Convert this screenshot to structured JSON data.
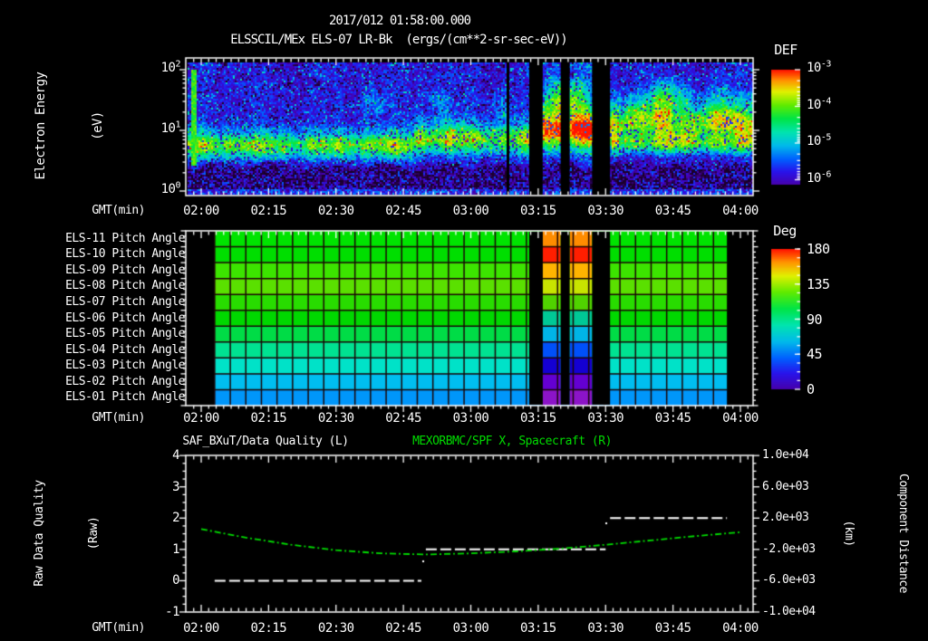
{
  "title": {
    "line1": "2017/012 01:58:00.000",
    "line2": "ELSSCIL/MEx ELS-07 LR-Bk  (ergs/(cm**2-sr-sec-eV))"
  },
  "time_axis": {
    "label": "GMT(min)",
    "ticks": [
      "02:00",
      "02:15",
      "02:30",
      "02:45",
      "03:00",
      "03:15",
      "03:30",
      "03:45",
      "04:00"
    ]
  },
  "panel1": {
    "ylabel": [
      "Electron Energy",
      "(eV)"
    ],
    "yticks": [
      {
        "base": "10",
        "exp": "2"
      },
      {
        "base": "10",
        "exp": "1"
      },
      {
        "base": "10",
        "exp": "0"
      }
    ],
    "colorbar": {
      "title": "DEF",
      "ticks": [
        {
          "base": "10",
          "exp": "-3"
        },
        {
          "base": "10",
          "exp": "-4"
        },
        {
          "base": "10",
          "exp": "-5"
        },
        {
          "base": "10",
          "exp": "-6"
        }
      ]
    }
  },
  "panel2": {
    "row_labels": [
      "ELS-11 Pitch Angle",
      "ELS-10 Pitch Angle",
      "ELS-09 Pitch Angle",
      "ELS-08 Pitch Angle",
      "ELS-07 Pitch Angle",
      "ELS-06 Pitch Angle",
      "ELS-05 Pitch Angle",
      "ELS-04 Pitch Angle",
      "ELS-03 Pitch Angle",
      "ELS-02 Pitch Angle",
      "ELS-01 Pitch Angle"
    ],
    "colorbar": {
      "title": "Deg",
      "ticks": [
        "180",
        "135",
        "90",
        "45",
        "0"
      ]
    }
  },
  "panel3": {
    "title_left": "SAF_BXuT/Data Quality (L)",
    "title_right": "MEXORBMC/SPF X, Spacecraft (R)",
    "title_right_color": "#00dc00",
    "ylabel_left": [
      "Raw Data Quality",
      "(Raw)"
    ],
    "ylabel_right": [
      "Component Distance",
      "(km)"
    ],
    "yticks_left": [
      "4",
      "3",
      "2",
      "1",
      "0",
      "-1"
    ],
    "yticks_right": [
      "1.0e+04",
      "6.0e+03",
      "2.0e+03",
      "-2.0e+03",
      "-6.0e+03",
      "-1.0e+04"
    ]
  },
  "chart_data": [
    {
      "type": "heatmap",
      "panel": "electron-energy-spectrogram",
      "title": "ELSSCIL/MEx ELS-07 LR-Bk",
      "units": "ergs/(cm**2-sr-sec-eV)",
      "xlabel": "GMT(min)",
      "x_range": [
        "02:00",
        "04:00"
      ],
      "ylabel": "Electron Energy (eV)",
      "y_scale": "log",
      "y_range_eV": [
        1,
        150
      ],
      "colorbar": {
        "label": "DEF",
        "scale": "log",
        "range": [
          1e-06,
          0.001
        ]
      },
      "data_gaps": [
        [
          "03:13",
          "03:16"
        ],
        [
          "03:20",
          "03:22"
        ],
        [
          "03:27",
          "03:31"
        ]
      ],
      "features": {
        "main_band_eV": [
          4,
          40
        ],
        "typical_band_value_DEF": 0.0001,
        "dark_below_eV": 3,
        "enhanced_green_after": "03:00"
      }
    },
    {
      "type": "heatmap",
      "panel": "pitch-angle-rows",
      "rows": [
        "ELS-11",
        "ELS-10",
        "ELS-09",
        "ELS-08",
        "ELS-07",
        "ELS-06",
        "ELS-05",
        "ELS-04",
        "ELS-03",
        "ELS-02",
        "ELS-01"
      ],
      "colorbar": {
        "label": "Deg",
        "range": [
          0,
          180
        ],
        "ticks": [
          180,
          135,
          90,
          45,
          0
        ]
      },
      "x_range": [
        "02:03",
        "03:57"
      ],
      "row_pitch_angle_deg_approx": [
        112,
        110,
        118,
        122,
        115,
        110,
        103,
        92,
        80,
        62,
        48
      ],
      "row_colors": [
        "#00e400",
        "#00de00",
        "#3ce400",
        "#5ae000",
        "#28dc00",
        "#00d800",
        "#00dc46",
        "#00e291",
        "#00e2c8",
        "#00bef0",
        "#0096fa"
      ],
      "disturbances": [
        {
          "from": "03:16",
          "to": "03:20"
        },
        {
          "from": "03:22",
          "to": "03:27"
        }
      ],
      "disturbed_row_colors": [
        "#ff8c00",
        "#ff1e00",
        "#ffb400",
        "#c8e400",
        "#50d200",
        "#00c896",
        "#00b4e6",
        "#0050fa",
        "#1400d2",
        "#6400d2",
        "#8c14c8"
      ],
      "data_gaps": [
        [
          "03:13",
          "03:16"
        ],
        [
          "03:20",
          "03:22"
        ],
        [
          "03:27",
          "03:31"
        ]
      ]
    },
    {
      "type": "line",
      "panel": "quality-and-distance",
      "xlabel": "GMT(min)",
      "ylim_left": [
        -1,
        4
      ],
      "ylim_right": [
        -10000,
        10000
      ],
      "ylabel_left": "Raw Data Quality (Raw)",
      "ylabel_right": "Component Distance (km)",
      "series": [
        {
          "name": "SAF_BXuT/Data Quality (L)",
          "axis": "left",
          "color": "#ffffff",
          "style": "dashed",
          "segments": [
            {
              "value": 0,
              "from": "02:03",
              "to": "02:49"
            },
            {
              "value": 1,
              "from": "02:50",
              "to": "03:30"
            },
            {
              "value": 2,
              "from": "03:31",
              "to": "03:57"
            }
          ]
        },
        {
          "name": "MEXORBMC/SPF X, Spacecraft (R)",
          "axis": "right",
          "color": "#00dc00",
          "style": "dashed",
          "x": [
            "02:00",
            "02:10",
            "02:20",
            "02:30",
            "02:40",
            "02:50",
            "03:00",
            "03:10",
            "03:20",
            "03:30",
            "03:40",
            "03:50",
            "04:00"
          ],
          "values_km": [
            600,
            -500,
            -1400,
            -2100,
            -2500,
            -2650,
            -2500,
            -2250,
            -1900,
            -1400,
            -850,
            -300,
            200
          ]
        }
      ]
    }
  ]
}
